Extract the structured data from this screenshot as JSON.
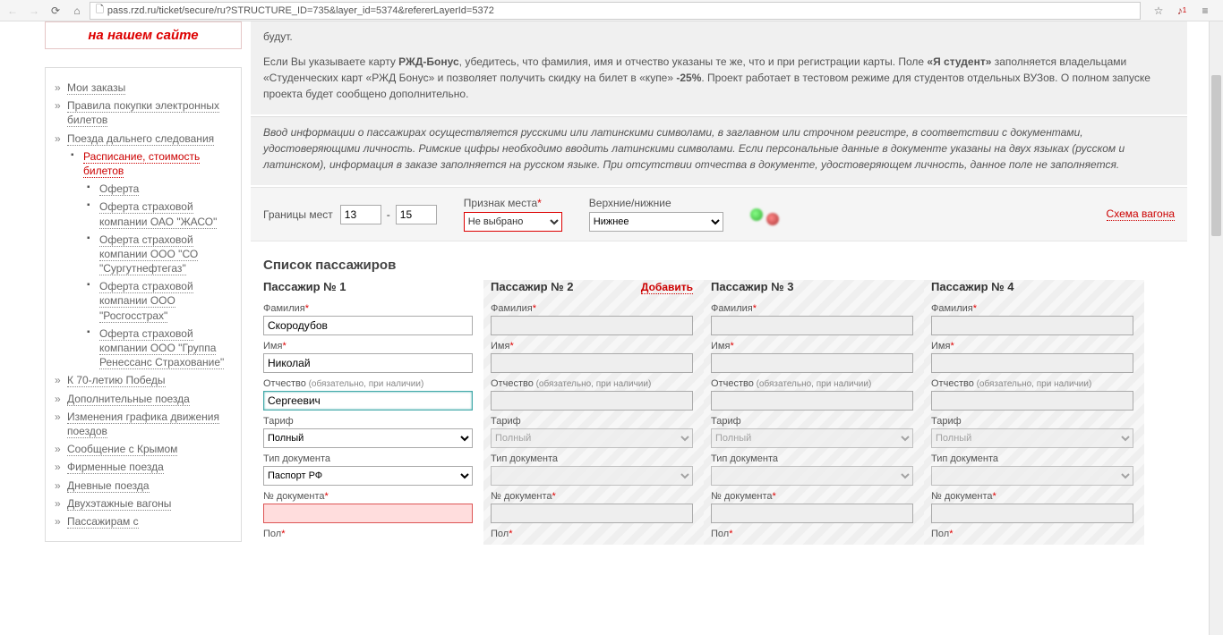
{
  "browser": {
    "url": "pass.rzd.ru/ticket/secure/ru?STRUCTURE_ID=735&layer_id=5374&refererLayerId=5372"
  },
  "logo": "на нашем сайте",
  "nav": {
    "items": [
      {
        "label": "Мои заказы"
      },
      {
        "label": "Правила покупки электронных билетов"
      },
      {
        "label": "Поезда дальнего следования",
        "children": [
          {
            "label": "Расписание, стоимость билетов",
            "red": true,
            "children": [
              {
                "label": "Оферта"
              },
              {
                "label": "Оферта страховой компании ОАО \"ЖАСО\""
              },
              {
                "label": "Оферта страховой компании ООО \"СО \"Сургутнефтегаз\""
              },
              {
                "label": "Оферта страховой компании ООО \"Росгосстрах\""
              },
              {
                "label": "Оферта страховой компании ООО \"Группа Ренессанс Страхование\""
              }
            ]
          }
        ]
      },
      {
        "label": "К 70-летию Победы"
      },
      {
        "label": "Дополнительные поезда"
      },
      {
        "label": "Изменения графика движения поездов"
      },
      {
        "label": "Сообщение с Крымом"
      },
      {
        "label": "Фирменные поезда"
      },
      {
        "label": "Дневные поезда"
      },
      {
        "label": "Двухэтажные вагоны"
      },
      {
        "label": "Пассажирам с"
      }
    ]
  },
  "info": {
    "p1_tail": "будут.",
    "p2_pre": "Если Вы указываете карту ",
    "p2_b1": "РЖД-Бонус",
    "p2_mid1": ", убедитесь, что фамилия, имя и отчество указаны те же, что и при регистрации карты. Поле ",
    "p2_b2": "«Я студент»",
    "p2_mid2": " заполняется владельцами «Студенческих карт «РЖД Бонус» и позволяет получить скидку на билет в «купе» ",
    "p2_b3": "-25%",
    "p2_end": ". Проект работает в тестовом режиме для студентов отдельных ВУЗов. О полном запуске проекта будет сообщено дополнительно.",
    "p3": "Ввод информации о пассажирах осуществляется русскими или латинскими символами, в заглавном или строчном регистре, в соответствии с документами, удостоверяющими личность. Римские цифры необходимо вводить латинскими символами. Если персональные данные в документе указаны на двух языках (русском и латинском), информация в заказе заполняется на русском языке. При отсутствии отчества в документе, удостоверяющем личность, данное поле не заполняется."
  },
  "controls": {
    "seats_label": "Границы мест",
    "seat_from": "13",
    "seat_dash": "-",
    "seat_to": "15",
    "attr_label": "Признак места",
    "attr_value": "Не выбрано",
    "level_label": "Верхние/нижние",
    "level_value": "Нижнее",
    "scheme": "Схема вагона"
  },
  "pax_section_title": "Список пассажиров",
  "field_labels": {
    "surname": "Фамилия",
    "name": "Имя",
    "patronymic": "Отчество",
    "patronymic_hint": "(обязательно, при наличии)",
    "tariff": "Тариф",
    "doctype": "Тип документа",
    "docnum": "№ документа",
    "gender": "Пол"
  },
  "common_values": {
    "tariff": "Полный",
    "doctype": "Паспорт РФ"
  },
  "misc": {
    "add_label": "Добавить"
  },
  "pax": [
    {
      "title": "Пассажир № 1",
      "surname": "Скородубов",
      "name": "Николай",
      "patronymic": "Сергеевич",
      "active": true,
      "show_add": false
    },
    {
      "title": "Пассажир № 2",
      "active": false,
      "show_add": true
    },
    {
      "title": "Пассажир № 3",
      "active": false,
      "show_add": false
    },
    {
      "title": "Пассажир № 4",
      "active": false,
      "show_add": false
    }
  ]
}
